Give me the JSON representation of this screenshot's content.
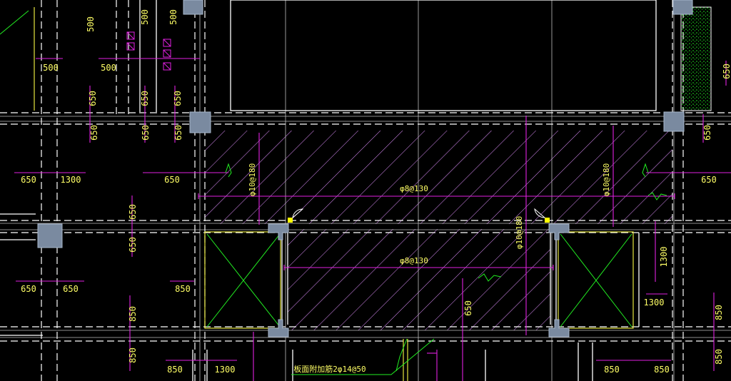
{
  "colors": {
    "background": "#000000",
    "grid": "#cfcfcf",
    "wall": "#ffffff",
    "dimension": "#e020e0",
    "dim_text": "#ffff66",
    "hatch": "#e090ff",
    "column_fill": "#7a8aa0",
    "column_stroke": "#a8b8cc",
    "green": "#22ee22",
    "yellow": "#e6e640",
    "marker": "#ffff00"
  },
  "dimensions": [
    {
      "id": "d500-a",
      "text": "500",
      "rotate": true
    },
    {
      "id": "d500-b",
      "text": "500",
      "rotate": true
    },
    {
      "id": "d500-c",
      "text": "500",
      "rotate": true
    },
    {
      "id": "d500-d",
      "text": "500",
      "rotate": false
    },
    {
      "id": "d500-e",
      "text": "500",
      "rotate": false
    },
    {
      "id": "d650-a",
      "text": "650",
      "rotate": true
    },
    {
      "id": "d650-b",
      "text": "650",
      "rotate": true
    },
    {
      "id": "d650-c",
      "text": "650",
      "rotate": true
    },
    {
      "id": "d650-d",
      "text": "650",
      "rotate": true
    },
    {
      "id": "d650-e",
      "text": "650",
      "rotate": true
    },
    {
      "id": "d650-f",
      "text": "650",
      "rotate": true
    },
    {
      "id": "d650-g",
      "text": "650",
      "rotate": true
    },
    {
      "id": "d650-h",
      "text": "650",
      "rotate": false
    },
    {
      "id": "d650-i",
      "text": "650",
      "rotate": false
    },
    {
      "id": "d1300-a",
      "text": "1300",
      "rotate": false
    },
    {
      "id": "d650-j",
      "text": "650",
      "rotate": true
    },
    {
      "id": "d650-k",
      "text": "650",
      "rotate": true
    },
    {
      "id": "d650-l",
      "text": "650",
      "rotate": false
    },
    {
      "id": "d650-m",
      "text": "650",
      "rotate": false
    },
    {
      "id": "d650-n",
      "text": "650",
      "rotate": false
    },
    {
      "id": "d850-a",
      "text": "850",
      "rotate": true
    },
    {
      "id": "d850-b",
      "text": "850",
      "rotate": true
    },
    {
      "id": "d850-c",
      "text": "850",
      "rotate": false
    },
    {
      "id": "d850-d",
      "text": "850",
      "rotate": false
    },
    {
      "id": "d1300-b",
      "text": "1300",
      "rotate": false
    },
    {
      "id": "d650-o",
      "text": "650",
      "rotate": true
    },
    {
      "id": "d1300-c",
      "text": "1300",
      "rotate": true
    },
    {
      "id": "d650-p",
      "text": "650",
      "rotate": false
    },
    {
      "id": "d1300-d",
      "text": "1300",
      "rotate": true
    },
    {
      "id": "d850-e",
      "text": "850",
      "rotate": false
    },
    {
      "id": "d850-f",
      "text": "850",
      "rotate": false
    },
    {
      "id": "d850-g",
      "text": "850",
      "rotate": true
    },
    {
      "id": "d850-h",
      "text": "850",
      "rotate": true
    }
  ],
  "rebar_labels": {
    "top_left": "φ10@180",
    "top_mid": "φ8@130",
    "top_right": "φ10@180",
    "mid_v": "φ10@180",
    "mid_h": "φ8@130",
    "bottom_note": "板面附加筋2φ14@50"
  }
}
